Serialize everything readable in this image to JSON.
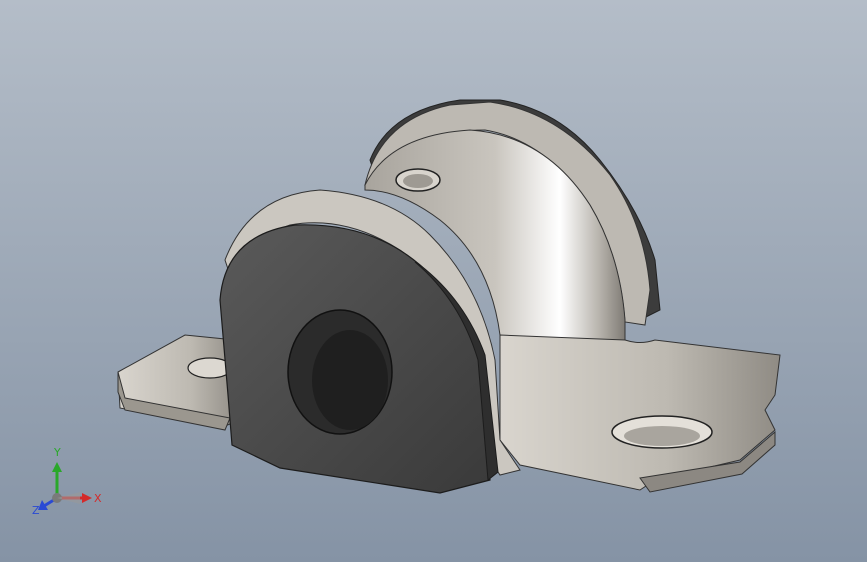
{
  "viewport": {
    "background_top": "#a9b3bf",
    "background_bottom": "#8c99aa"
  },
  "model": {
    "part_name": "bushing-bracket",
    "bushing_color": "#4a4a4a",
    "bracket_color": "#c9c5bd"
  },
  "triad": {
    "x_label": "X",
    "y_label": "Y",
    "z_label": "Z",
    "x_color": "#d42a2a",
    "y_color": "#2aa82a",
    "z_color": "#2a4ad4"
  }
}
